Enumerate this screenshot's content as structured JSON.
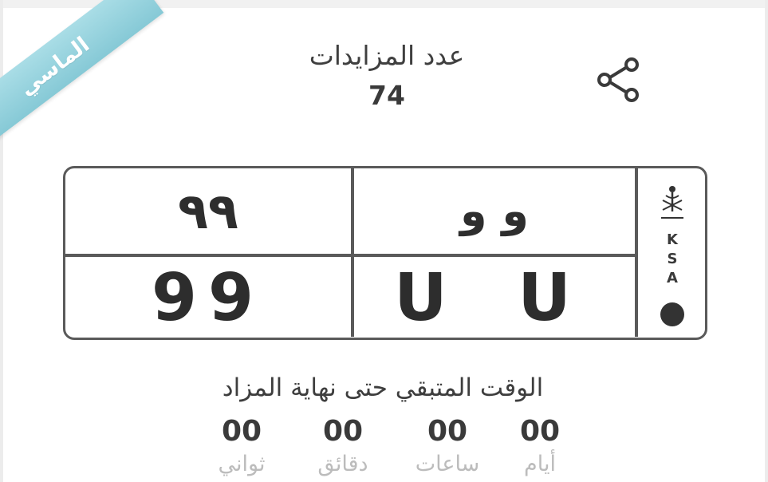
{
  "ribbon": {
    "label": "الماسي",
    "color": "#94d1dc"
  },
  "header": {
    "bids_label": "عدد المزايدات",
    "bids_count": "74",
    "share_icon": "share-icon"
  },
  "plate": {
    "number_ar": "٩٩",
    "letters_ar": "و و",
    "number_en": "99",
    "letters_en": "U U",
    "country_code": [
      "K",
      "S",
      "A"
    ],
    "emblem_icon": "saudi-emblem-icon"
  },
  "countdown": {
    "title": "الوقت المتبقي حتى نهاية المزاد",
    "days": {
      "value": "00",
      "label": "أيام"
    },
    "hours": {
      "value": "00",
      "label": "ساعات"
    },
    "minutes": {
      "value": "00",
      "label": "دقائق"
    },
    "seconds": {
      "value": "00",
      "label": "ثواني"
    }
  }
}
